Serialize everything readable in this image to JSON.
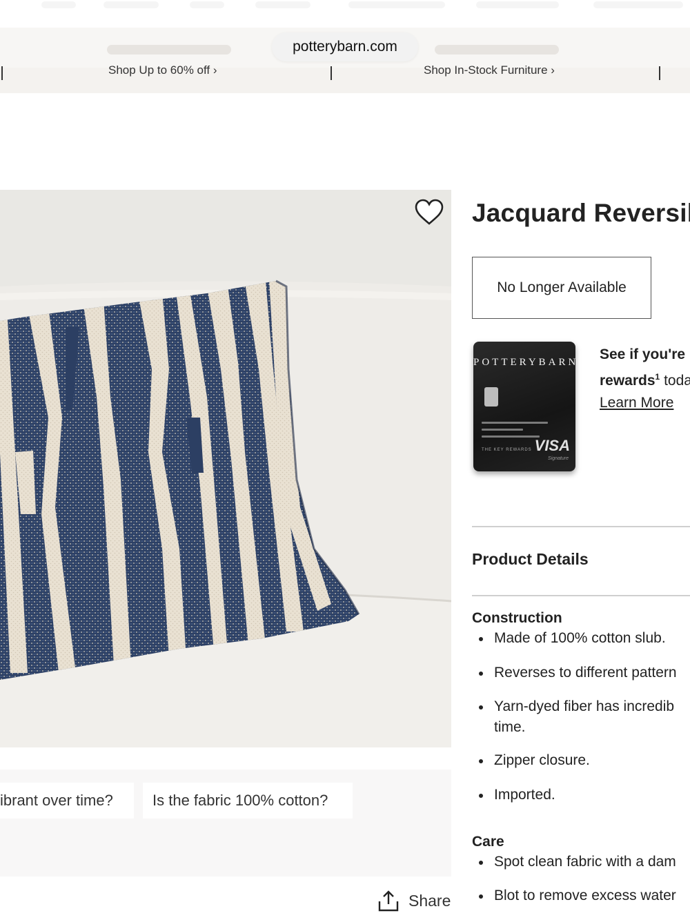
{
  "browser": {
    "url": "potterybarn.com"
  },
  "promo_bar": {
    "links": [
      "Shop Up to 60% off ›",
      "Shop In-Stock Furniture ›"
    ]
  },
  "product": {
    "title": "Jacquard Reversib",
    "status_button": "No Longer Available",
    "image_alt_icon": "heart-icon"
  },
  "credit_card_promo": {
    "card_brand": "POTTERYBARN",
    "card_network": "VISA",
    "card_network_sub": "Signature",
    "card_rewards_text": "THE KEY REWARDS",
    "line1": "See if you're",
    "line2_bold": "rewards",
    "line2_sup": "1",
    "line2_rest": " toda",
    "learn_more": "Learn More"
  },
  "details": {
    "section_title": "Product Details",
    "construction": {
      "heading": "Construction",
      "items": [
        "Made of 100% cotton slub.",
        "Reverses to different pattern",
        "Yarn-dyed fiber has incredib",
        "time.",
        "Zipper closure.",
        "Imported."
      ]
    },
    "care": {
      "heading": "Care",
      "items": [
        "Spot clean fabric with a dam",
        "Blot to remove excess water"
      ]
    }
  },
  "questions": {
    "chips": [
      "ibrant over time?",
      "Is the fabric 100% cotton?"
    ]
  },
  "share": {
    "label": "Share",
    "icon": "share-icon"
  },
  "colors": {
    "navy": "#2c3f63",
    "cream": "#e9e1d2",
    "promo_bg": "#f4f2ef",
    "chip_bg": "#f8f7f7"
  }
}
